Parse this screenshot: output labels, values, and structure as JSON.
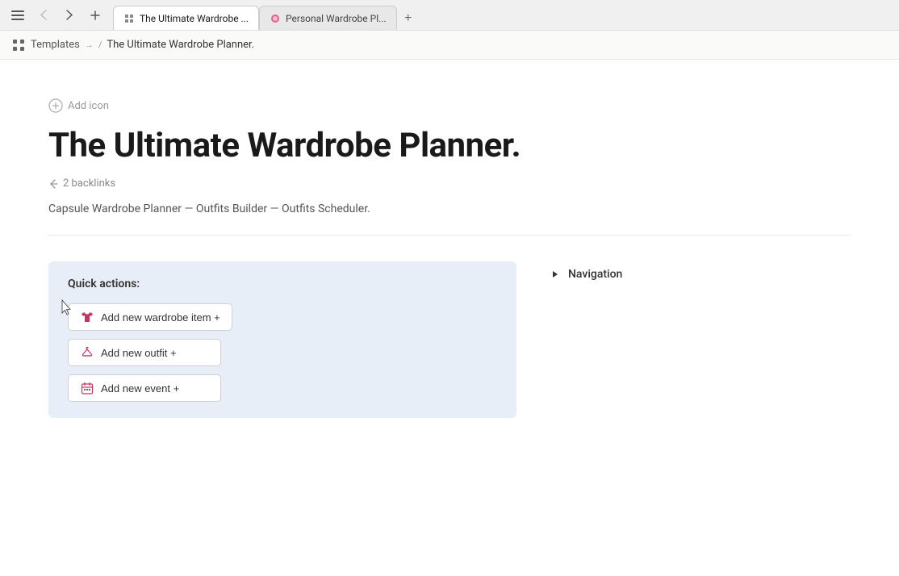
{
  "browser": {
    "nav": {
      "menu_label": "≡",
      "back_label": "‹",
      "forward_label": "›",
      "new_tab_label": "+"
    },
    "tabs": [
      {
        "id": "tab1",
        "title": "The Ultimate Wardrobe ...",
        "active": true,
        "icon": "notion-icon"
      },
      {
        "id": "tab2",
        "title": "Personal Wardrobe Pl...",
        "active": false,
        "icon": "pink-icon"
      }
    ]
  },
  "breadcrumb": {
    "icon": "templates-icon",
    "link_label": "Templates",
    "arrow": "→",
    "separator": "/",
    "current": "The Ultimate Wardrobe Planner."
  },
  "page": {
    "add_icon_label": "Add icon",
    "title": "The Ultimate Wardrobe Planner.",
    "backlinks_icon": "✎",
    "backlinks_count": "2 backlinks",
    "subtitle": "Capsule Wardrobe Planner — Outfits Builder — Outfits Scheduler."
  },
  "quick_actions": {
    "title": "Quick actions:",
    "buttons": [
      {
        "id": "btn1",
        "icon": "shirt-icon",
        "label": "Add new wardrobe item +"
      },
      {
        "id": "btn2",
        "icon": "hanger-icon",
        "label": "Add new outfit +"
      },
      {
        "id": "btn3",
        "icon": "calendar-icon",
        "label": "Add new event +"
      }
    ]
  },
  "navigation": {
    "toggle": "▶",
    "label": "Navigation"
  },
  "icons": {
    "shirt": "👕",
    "hanger": "🧥",
    "calendar": "📅",
    "add_icon": "⊕",
    "backlink": "↖",
    "back_arrow": "❮",
    "forward_arrow": "❯"
  },
  "colors": {
    "accent_pink": "#c0365e",
    "card_bg": "#e8eef8",
    "active_tab_bg": "#ffffff"
  }
}
